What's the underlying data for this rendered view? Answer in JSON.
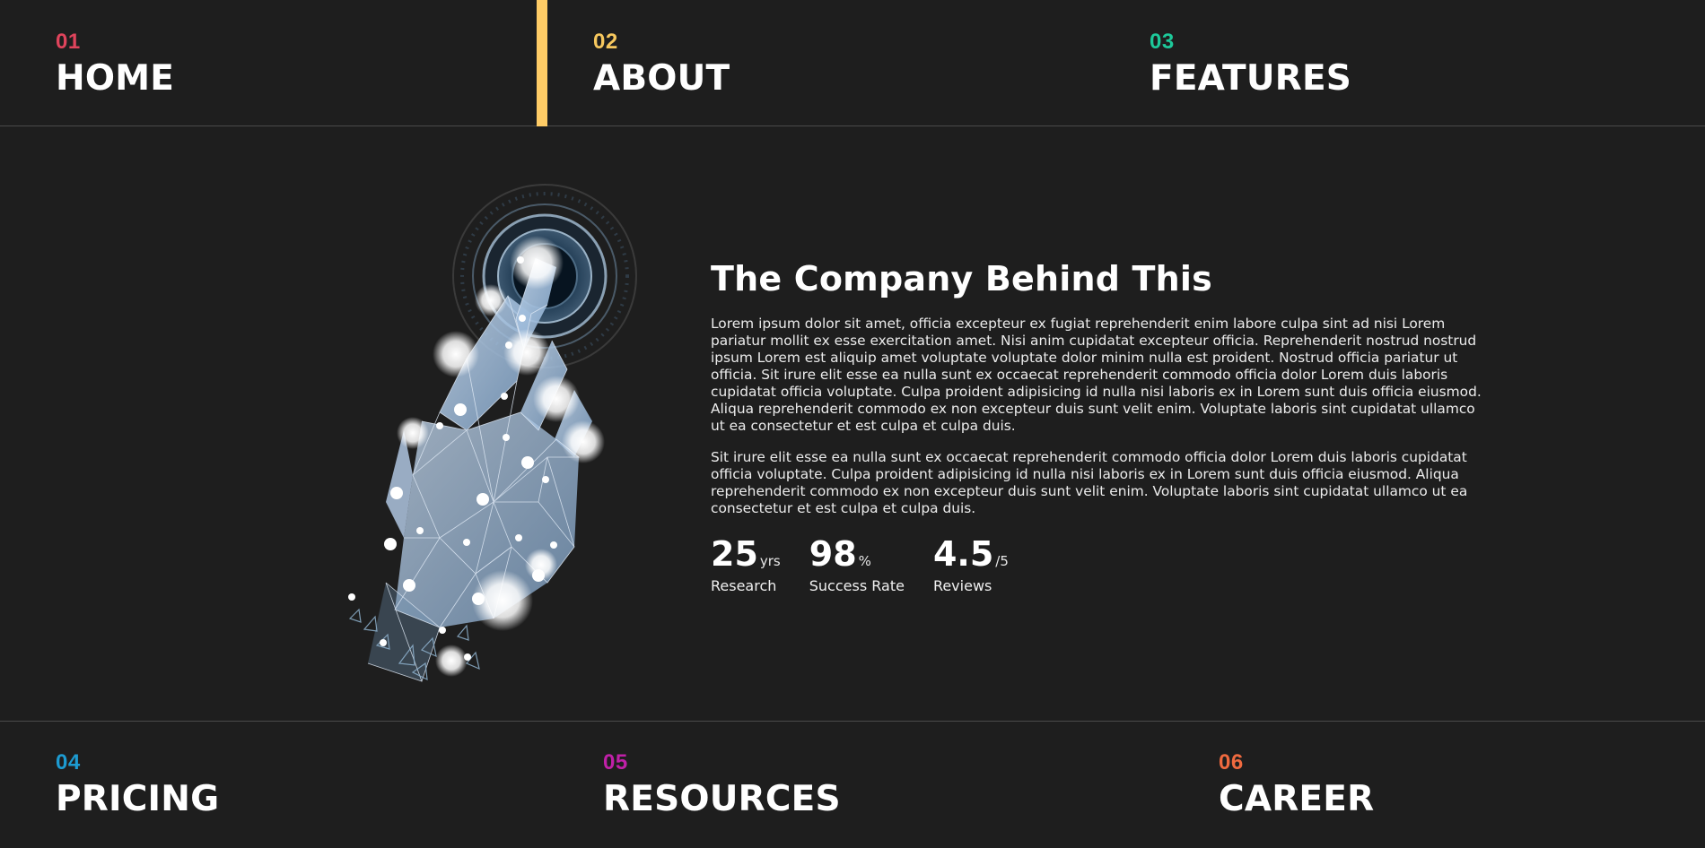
{
  "colors": {
    "background": "#1e1e1e",
    "accent_bar": "#ffcc66",
    "home": "#e0445c",
    "about": "#f7c85e",
    "features": "#1dc99a",
    "pricing": "#1d9bd1",
    "resources": "#c020a8",
    "career": "#f06a3f"
  },
  "nav_top": [
    {
      "number": "01",
      "label": "HOME"
    },
    {
      "number": "02",
      "label": "ABOUT"
    },
    {
      "number": "03",
      "label": "FEATURES"
    }
  ],
  "nav_bottom": [
    {
      "number": "04",
      "label": "PRICING"
    },
    {
      "number": "05",
      "label": "RESOURCES"
    },
    {
      "number": "06",
      "label": "CAREER"
    }
  ],
  "hero": {
    "image_icon": "robotic-hand-touch-icon",
    "title": "The Company Behind This",
    "paragraphs": [
      "Lorem ipsum dolor sit amet, officia excepteur ex fugiat reprehenderit enim labore culpa sint ad nisi Lorem pariatur mollit ex esse exercitation amet. Nisi anim cupidatat excepteur officia. Reprehenderit nostrud nostrud ipsum Lorem est aliquip amet voluptate voluptate dolor minim nulla est proident. Nostrud officia pariatur ut officia. Sit irure elit esse ea nulla sunt ex occaecat reprehenderit commodo officia dolor Lorem duis laboris cupidatat officia voluptate. Culpa proident adipisicing id nulla nisi laboris ex in Lorem sunt duis officia eiusmod. Aliqua reprehenderit commodo ex non excepteur duis sunt velit enim. Voluptate laboris sint cupidatat ullamco ut ea consectetur et est culpa et culpa duis.",
      "Sit irure elit esse ea nulla sunt ex occaecat reprehenderit commodo officia dolor Lorem duis laboris cupidatat officia voluptate. Culpa proident adipisicing id nulla nisi laboris ex in Lorem sunt duis officia eiusmod. Aliqua reprehenderit commodo ex non excepteur duis sunt velit enim. Voluptate laboris sint cupidatat ullamco ut ea consectetur et est culpa et culpa duis."
    ],
    "stats": [
      {
        "value": "25",
        "unit": "yrs",
        "label": "Research"
      },
      {
        "value": "98",
        "unit": "%",
        "label": "Success Rate"
      },
      {
        "value": "4.5",
        "unit": "/5",
        "label": "Reviews"
      }
    ]
  }
}
